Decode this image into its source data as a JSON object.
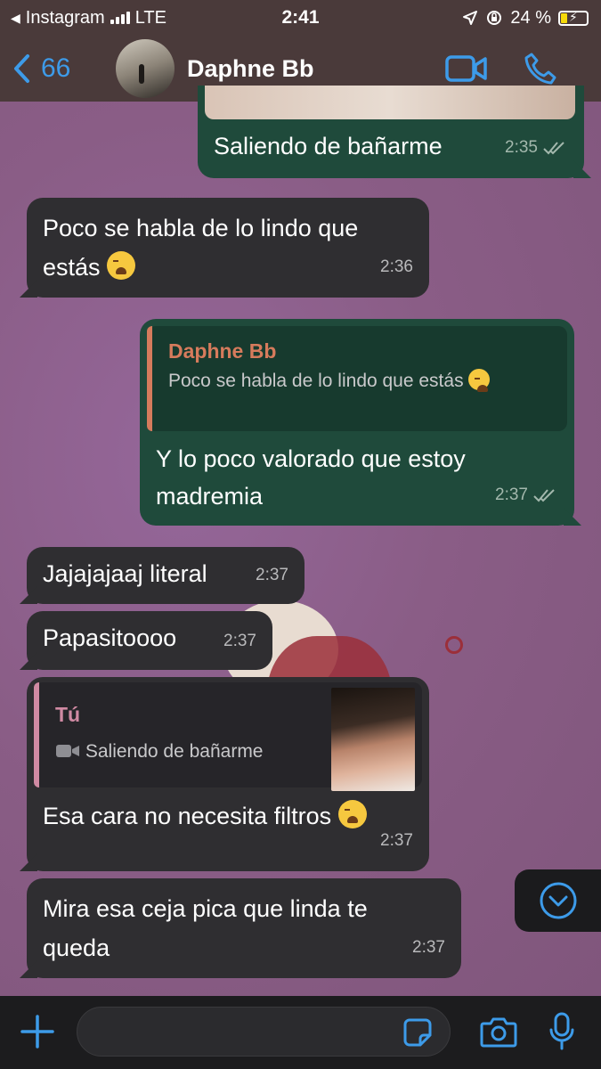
{
  "status_bar": {
    "back_app": "Instagram",
    "network": "LTE",
    "time": "2:41",
    "battery": "24 %"
  },
  "header": {
    "back_count": "66",
    "contact_name": "Daphne Bb"
  },
  "messages": [
    {
      "dir": "out",
      "text": "Saliendo de bañarme",
      "time": "2:35",
      "read": true
    },
    {
      "dir": "in",
      "text_line1": "Poco se habla de lo lindo que",
      "text_line2": "estás",
      "emoji": "crying-face",
      "time": "2:36"
    },
    {
      "dir": "out",
      "quote_author": "Daphne Bb",
      "quote_text": "Poco se habla de lo lindo que estás",
      "quote_emoji": "crying-face",
      "text_line1": "Y lo poco valorado que estoy",
      "text_line2": "madremia",
      "time": "2:37",
      "read": true
    },
    {
      "dir": "in",
      "text": "Jajajajaaj literal",
      "time": "2:37"
    },
    {
      "dir": "in",
      "text": "Papasitoooo",
      "time": "2:37"
    },
    {
      "dir": "in",
      "quote_author": "Tú",
      "quote_text": "Saliendo de bañarme",
      "quote_icon": "video-icon",
      "text": "Esa cara no necesita filtros",
      "emoji": "crying-face",
      "time": "2:37"
    },
    {
      "dir": "in",
      "text_line1": "Mira esa ceja pica que linda te",
      "text_line2": "queda",
      "time": "2:37"
    }
  ],
  "composer": {
    "placeholder": ""
  },
  "colors": {
    "accent": "#3d9be9",
    "incoming": "#2f2e31",
    "outgoing": "#1f4a3b",
    "wallpaper": "#8a5d86"
  }
}
